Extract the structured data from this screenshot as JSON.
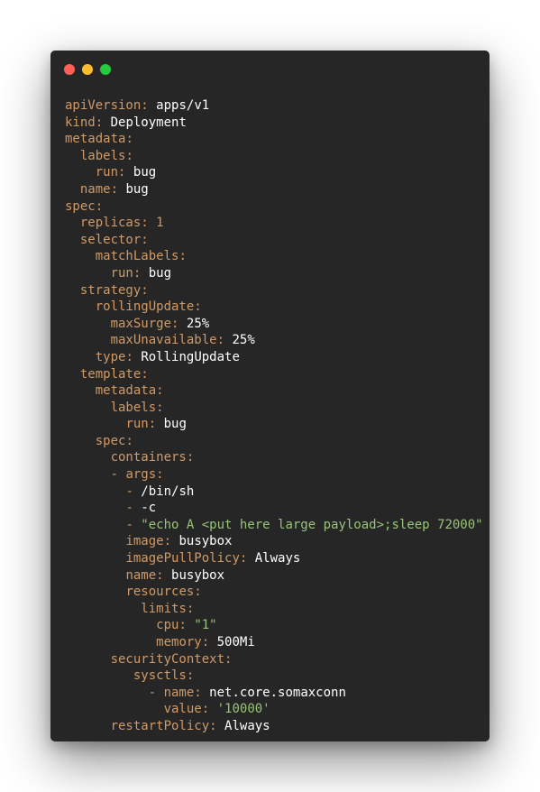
{
  "window": {
    "controls": {
      "close_color": "#ff5f56",
      "minimize_color": "#ffbd2e",
      "zoom_color": "#27c93f"
    }
  },
  "colors": {
    "background": "#262626",
    "key": "#d19a66",
    "string": "#98c379",
    "plain": "#ffffff"
  },
  "code_lines": [
    {
      "indent": 0,
      "dash": false,
      "key": "apiVersion",
      "value": "apps/v1",
      "type": "plain"
    },
    {
      "indent": 0,
      "dash": false,
      "key": "kind",
      "value": "Deployment",
      "type": "plain"
    },
    {
      "indent": 0,
      "dash": false,
      "key": "metadata",
      "value": "",
      "type": "none"
    },
    {
      "indent": 1,
      "dash": false,
      "key": "labels",
      "value": "",
      "type": "none"
    },
    {
      "indent": 2,
      "dash": false,
      "key": "run",
      "value": "bug",
      "type": "plain"
    },
    {
      "indent": 1,
      "dash": false,
      "key": "name",
      "value": "bug",
      "type": "plain"
    },
    {
      "indent": 0,
      "dash": false,
      "key": "spec",
      "value": "",
      "type": "none"
    },
    {
      "indent": 1,
      "dash": false,
      "key": "replicas",
      "value": "1",
      "type": "number"
    },
    {
      "indent": 1,
      "dash": false,
      "key": "selector",
      "value": "",
      "type": "none"
    },
    {
      "indent": 2,
      "dash": false,
      "key": "matchLabels",
      "value": "",
      "type": "none"
    },
    {
      "indent": 3,
      "dash": false,
      "key": "run",
      "value": "bug",
      "type": "plain"
    },
    {
      "indent": 1,
      "dash": false,
      "key": "strategy",
      "value": "",
      "type": "none"
    },
    {
      "indent": 2,
      "dash": false,
      "key": "rollingUpdate",
      "value": "",
      "type": "none"
    },
    {
      "indent": 3,
      "dash": false,
      "key": "maxSurge",
      "value": "25%",
      "type": "plain"
    },
    {
      "indent": 3,
      "dash": false,
      "key": "maxUnavailable",
      "value": "25%",
      "type": "plain"
    },
    {
      "indent": 2,
      "dash": false,
      "key": "type",
      "value": "RollingUpdate",
      "type": "plain"
    },
    {
      "indent": 1,
      "dash": false,
      "key": "template",
      "value": "",
      "type": "none"
    },
    {
      "indent": 2,
      "dash": false,
      "key": "metadata",
      "value": "",
      "type": "none"
    },
    {
      "indent": 3,
      "dash": false,
      "key": "labels",
      "value": "",
      "type": "none"
    },
    {
      "indent": 4,
      "dash": false,
      "key": "run",
      "value": "bug",
      "type": "plain"
    },
    {
      "indent": 2,
      "dash": false,
      "key": "spec",
      "value": "",
      "type": "none"
    },
    {
      "indent": 3,
      "dash": false,
      "key": "containers",
      "value": "",
      "type": "none"
    },
    {
      "indent": 3,
      "dash": true,
      "key": "args",
      "value": "",
      "type": "none"
    },
    {
      "indent": 4,
      "dash": true,
      "key": null,
      "value": "/bin/sh",
      "type": "plain"
    },
    {
      "indent": 4,
      "dash": true,
      "key": null,
      "value": "-c",
      "type": "plain"
    },
    {
      "indent": 4,
      "dash": true,
      "key": null,
      "value": "\"echo A <put here large payload>;sleep 72000\"",
      "type": "string"
    },
    {
      "indent": 4,
      "dash": false,
      "key": "image",
      "value": "busybox",
      "type": "plain"
    },
    {
      "indent": 4,
      "dash": false,
      "key": "imagePullPolicy",
      "value": "Always",
      "type": "plain"
    },
    {
      "indent": 4,
      "dash": false,
      "key": "name",
      "value": "busybox",
      "type": "plain"
    },
    {
      "indent": 4,
      "dash": false,
      "key": "resources",
      "value": "",
      "type": "none"
    },
    {
      "indent": 5,
      "dash": false,
      "key": "limits",
      "value": "",
      "type": "none"
    },
    {
      "indent": 6,
      "dash": false,
      "key": "cpu",
      "value": "\"1\"",
      "type": "string"
    },
    {
      "indent": 6,
      "dash": false,
      "key": "memory",
      "value": "500Mi",
      "type": "plain"
    },
    {
      "indent": 3,
      "dash": false,
      "key": "securityContext",
      "value": "",
      "type": "none"
    },
    {
      "indent": 4.5,
      "dash": false,
      "key": "sysctls",
      "value": "",
      "type": "none"
    },
    {
      "indent": 5.5,
      "dash": true,
      "key": "name",
      "value": "net.core.somaxconn",
      "type": "plain"
    },
    {
      "indent": 6.5,
      "dash": false,
      "key": "value",
      "value": "'10000'",
      "type": "string"
    },
    {
      "indent": 3,
      "dash": false,
      "key": "restartPolicy",
      "value": "Always",
      "type": "plain"
    }
  ]
}
